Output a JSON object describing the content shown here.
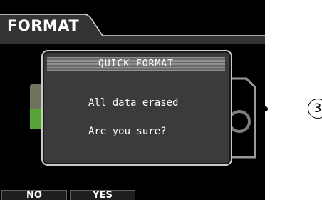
{
  "screen": {
    "tab_title": "FORMAT"
  },
  "dialog": {
    "title": "QUICK FORMAT",
    "line1": "All data erased",
    "line2": "Are you sure?"
  },
  "buttons": {
    "no": "NO",
    "yes": "YES"
  },
  "callout": {
    "number": "3"
  },
  "colors": {
    "screen_bg": "#000000",
    "dialog_bg": "#3b3b3b",
    "dialog_border": "#c9c9c9",
    "tab_bg": "#333333",
    "green_accent": "#5aa238"
  }
}
